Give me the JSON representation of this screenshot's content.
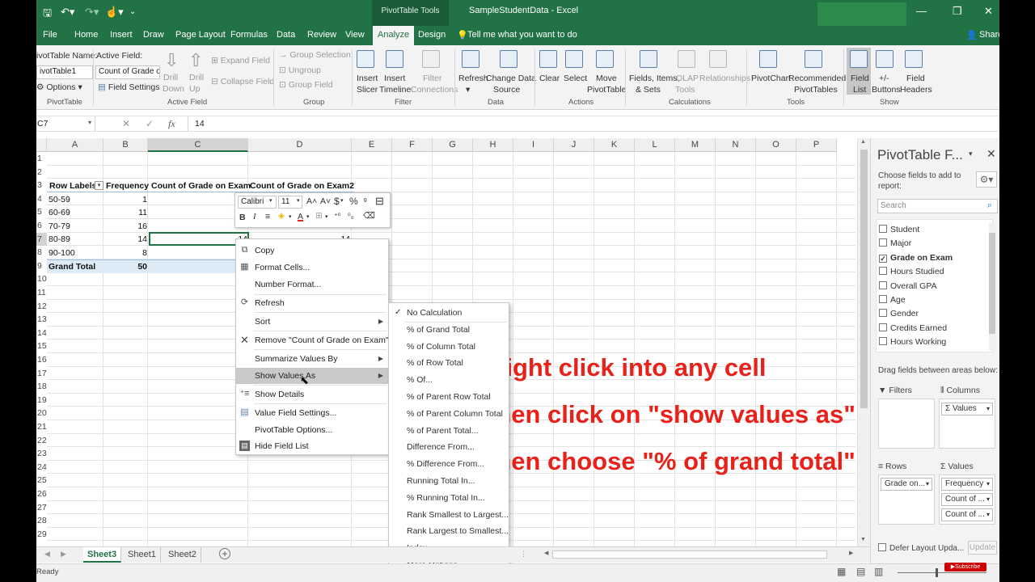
{
  "window": {
    "context_tab": "PivotTable Tools",
    "title": "SampleStudentData - Excel",
    "share": "Share",
    "minimize": "—",
    "restore": "❐",
    "close": "✕"
  },
  "tabs": [
    "File",
    "Home",
    "Insert",
    "Draw",
    "Page Layout",
    "Formulas",
    "Data",
    "Review",
    "View",
    "Analyze",
    "Design"
  ],
  "tell_me": "Tell me what you want to do",
  "ribbon": {
    "pt_name_label": "ivotTable Name:",
    "pt_name_value": "ivotTable1",
    "options": "Options",
    "group_pivottable": "PivotTable",
    "active_field_label": "Active Field:",
    "active_field_value": "Count of Grade on",
    "field_settings": "Field Settings",
    "drill_down": [
      "Drill",
      "Down"
    ],
    "drill_up": [
      "Drill",
      "Up"
    ],
    "expand_field": "Expand Field",
    "collapse_field": "Collapse Field",
    "group_active_field": "Active Field",
    "group_selection": "Group Selection",
    "ungroup": "Ungroup",
    "group_field": "Group Field",
    "group_group": "Group",
    "insert_slicer": [
      "Insert",
      "Slicer"
    ],
    "insert_timeline": [
      "Insert",
      "Timeline"
    ],
    "filter_connections": [
      "Filter",
      "Connections"
    ],
    "group_filter": "Filter",
    "refresh": "Refresh",
    "change_data_source": [
      "Change Data",
      "Source"
    ],
    "group_data": "Data",
    "clear": "Clear",
    "select": "Select",
    "move_pivottable": [
      "Move",
      "PivotTable"
    ],
    "group_actions": "Actions",
    "fields_items_sets": [
      "Fields, Items,",
      "& Sets"
    ],
    "olap_tools": [
      "OLAP",
      "Tools"
    ],
    "relationships": "Relationships",
    "group_calculations": "Calculations",
    "pivotchart": "PivotChart",
    "recommended_pivottables": [
      "Recommended",
      "PivotTables"
    ],
    "group_tools": "Tools",
    "field_list": [
      "Field",
      "List"
    ],
    "buttons": [
      "+/-",
      "Buttons"
    ],
    "field_headers": [
      "Field",
      "Headers"
    ],
    "group_show": "Show"
  },
  "formula_bar": {
    "name_box": "C7",
    "fx": "fx",
    "value": "14"
  },
  "columns": [
    "A",
    "B",
    "C",
    "D",
    "E",
    "F",
    "G",
    "H",
    "I",
    "J",
    "K",
    "L",
    "M",
    "N",
    "O",
    "P"
  ],
  "rows": [
    "1",
    "2",
    "3",
    "4",
    "5",
    "6",
    "7",
    "8",
    "9",
    "10",
    "11",
    "12",
    "13",
    "14",
    "15",
    "16",
    "17",
    "18",
    "19",
    "20",
    "21",
    "22",
    "23",
    "24",
    "25",
    "26",
    "27",
    "28",
    "29"
  ],
  "pivot": {
    "headers": [
      "Row Labels",
      "Frequency",
      "Count of Grade on Exam",
      "Count of Grade on Exam2"
    ],
    "rows": [
      {
        "label": "50-59",
        "freq": "1"
      },
      {
        "label": "60-69",
        "freq": "11"
      },
      {
        "label": "70-79",
        "freq": "16"
      },
      {
        "label": "80-89",
        "freq": "14",
        "c": "14",
        "d": "14"
      },
      {
        "label": "90-100",
        "freq": "8"
      }
    ],
    "grand_total": {
      "label": "Grand Total",
      "freq": "50"
    }
  },
  "mini_toolbar": {
    "font": "Calibri",
    "size": "11"
  },
  "context_menu": [
    {
      "label": "Copy",
      "icon": "copy-icon"
    },
    {
      "label": "Format Cells..."
    },
    {
      "label": "Number Format..."
    },
    {
      "label": "Refresh",
      "icon": "refresh-icon"
    },
    {
      "label": "Sort",
      "arrow": true
    },
    {
      "label": "Remove \"Count of Grade on Exam\"",
      "icon": "remove-icon"
    },
    {
      "label": "Summarize Values By",
      "arrow": true
    },
    {
      "label": "Show Values As",
      "arrow": true,
      "highlight": true
    },
    {
      "label": "Show Details",
      "icon": "show-details-icon"
    },
    {
      "label": "Value Field Settings...",
      "icon": "value-field-settings-icon"
    },
    {
      "label": "PivotTable Options..."
    },
    {
      "label": "Hide Field List",
      "icon": "hide-field-list-icon"
    }
  ],
  "submenu": [
    "No Calculation",
    "% of Grand Total",
    "% of Column Total",
    "% of Row Total",
    "% Of...",
    "% of Parent Row Total",
    "% of Parent Column Total",
    "% of Parent Total...",
    "Difference From...",
    "% Difference From...",
    "Running Total In...",
    "% Running Total In...",
    "Rank Smallest to Largest...",
    "Rank Largest to Smallest...",
    "Index",
    "More Options..."
  ],
  "annotation": [
    "Right click into any cell",
    "then click on \"show values as\"",
    "then choose \"% of grand total\""
  ],
  "sheets": [
    "Sheet3",
    "Sheet1",
    "Sheet2"
  ],
  "status": "Ready",
  "pane": {
    "title": "PivotTable F...",
    "choose_label": "Choose fields to add to report:",
    "search_placeholder": "Search",
    "fields": [
      {
        "name": "Student",
        "checked": false
      },
      {
        "name": "Major",
        "checked": false
      },
      {
        "name": "Grade on Exam",
        "checked": true
      },
      {
        "name": "Hours Studied",
        "checked": false
      },
      {
        "name": "Overall GPA",
        "checked": false
      },
      {
        "name": "Age",
        "checked": false
      },
      {
        "name": "Gender",
        "checked": false
      },
      {
        "name": "Credits Earned",
        "checked": false
      },
      {
        "name": "Hours Working",
        "checked": false
      }
    ],
    "drag_label": "Drag fields between areas below:",
    "filters": "Filters",
    "columns": "Columns",
    "columns_item": "Σ Values",
    "rows": "Rows",
    "rows_item": "Grade on...",
    "values": "Values",
    "values_items": [
      "Frequency",
      "Count of ...",
      "Count of ..."
    ],
    "defer": "Defer Layout Upda...",
    "update": "Update"
  },
  "subscribe": "Subscribe"
}
